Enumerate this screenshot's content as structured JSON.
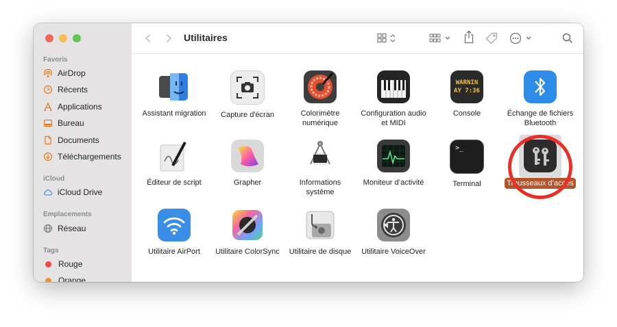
{
  "window": {
    "title": "Utilitaires",
    "traffic_lights": {
      "close": "#ee6a5f",
      "minimize": "#f5be4f",
      "zoom": "#62c654"
    }
  },
  "sidebar": {
    "sections": [
      {
        "heading": "Favoris",
        "items": [
          {
            "label": "AirDrop",
            "icon": "airdrop-icon"
          },
          {
            "label": "Récents",
            "icon": "clock-icon"
          },
          {
            "label": "Applications",
            "icon": "applications-icon"
          },
          {
            "label": "Bureau",
            "icon": "desktop-icon"
          },
          {
            "label": "Documents",
            "icon": "document-icon"
          },
          {
            "label": "Téléchargements",
            "icon": "download-icon"
          }
        ]
      },
      {
        "heading": "iCloud",
        "items": [
          {
            "label": "iCloud Drive",
            "icon": "cloud-icon"
          }
        ]
      },
      {
        "heading": "Emplacements",
        "items": [
          {
            "label": "Réseau",
            "icon": "globe-icon"
          }
        ]
      },
      {
        "heading": "Tags",
        "items": [
          {
            "label": "Rouge",
            "color": "#ee4a3f"
          },
          {
            "label": "Orange",
            "color": "#f0902f"
          }
        ]
      }
    ]
  },
  "accent_color": "#e6791f",
  "apps": [
    {
      "name": "Assistant migration",
      "icon": "migration-assistant-icon"
    },
    {
      "name": "Capture d'écran",
      "icon": "screenshot-icon"
    },
    {
      "name": "Colorimètre numérique",
      "icon": "color-meter-icon"
    },
    {
      "name": "Configuration audio et MIDI",
      "icon": "audio-midi-icon"
    },
    {
      "name": "Console",
      "icon": "console-icon",
      "icon_text": [
        "WARNIN",
        "AY 7:36"
      ]
    },
    {
      "name": "Échange de fichiers Bluetooth",
      "icon": "bluetooth-icon"
    },
    {
      "name": "Éditeur de script",
      "icon": "script-editor-icon"
    },
    {
      "name": "Grapher",
      "icon": "grapher-icon"
    },
    {
      "name": "Informations système",
      "icon": "system-info-icon"
    },
    {
      "name": "Moniteur d’activité",
      "icon": "activity-monitor-icon"
    },
    {
      "name": "Terminal",
      "icon": "terminal-icon",
      "icon_text": [
        ">_"
      ]
    },
    {
      "name": "Trousseaux d’accès",
      "icon": "keychain-icon",
      "selected": true,
      "highlight_color": "#e83028"
    },
    {
      "name": "Utilitaire AirPort",
      "icon": "airport-utility-icon"
    },
    {
      "name": "Utilitaire ColorSync",
      "icon": "colorsync-icon"
    },
    {
      "name": "Utilitaire de disque",
      "icon": "disk-utility-icon"
    },
    {
      "name": "Utilitaire VoiceOver",
      "icon": "voiceover-icon"
    }
  ]
}
